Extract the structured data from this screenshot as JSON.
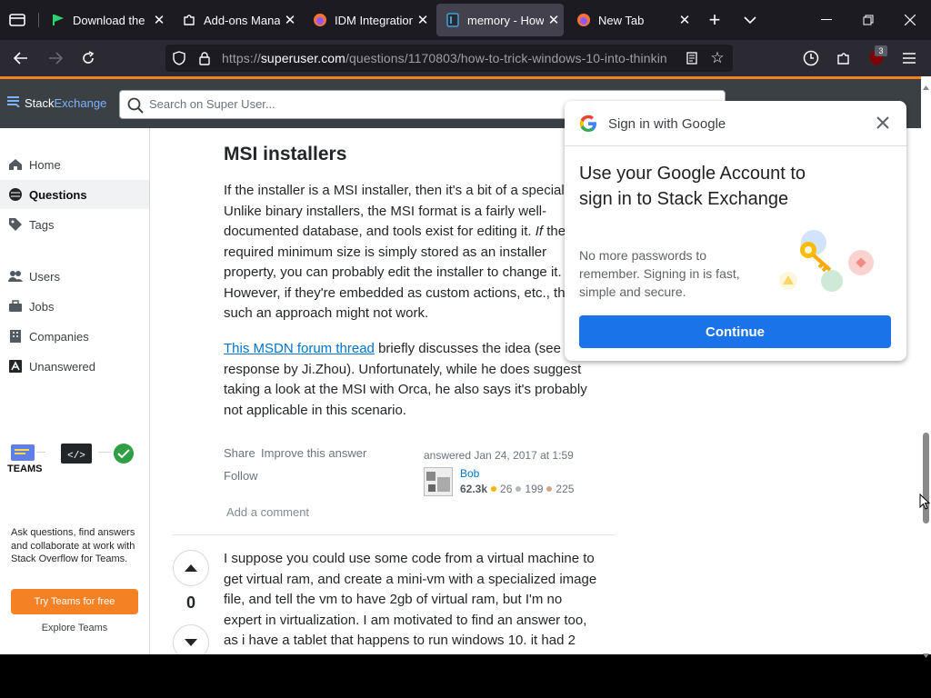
{
  "browser": {
    "tabs": [
      {
        "title": "Download the la",
        "favicon": "green-flag-icon"
      },
      {
        "title": "Add-ons Manag",
        "favicon": "puzzle-icon"
      },
      {
        "title": "IDM Integration",
        "favicon": "firefox-icon"
      },
      {
        "title": "memory - How",
        "favicon": "superuser-icon",
        "active": true
      },
      {
        "title": "New Tab",
        "favicon": "firefox-icon"
      }
    ],
    "url_prefix": "https://",
    "url_host": "superuser.com",
    "url_path": "/questions/1170803/how-to-trick-windows-10-into-thinkin",
    "extension_badge": "3"
  },
  "site": {
    "logo_a": "Stack",
    "logo_b": "Exchange",
    "search_placeholder": "Search on Super User..."
  },
  "leftnav": {
    "items": [
      {
        "label": "Home",
        "icon": "home-icon"
      },
      {
        "label": "Questions",
        "icon": "globe-icon",
        "selected": true
      },
      {
        "label": "Tags",
        "icon": "tag-icon"
      },
      {
        "label": "Users",
        "icon": "users-icon"
      },
      {
        "label": "Jobs",
        "icon": "briefcase-icon"
      },
      {
        "label": "Companies",
        "icon": "building-icon"
      },
      {
        "label": "Unanswered",
        "icon": "unanswered-icon"
      }
    ],
    "teams_heading": "TEAMS",
    "teams_text": "Ask questions, find answers and collaborate at work with Stack Overflow for Teams.",
    "teams_button": "Try Teams for free",
    "teams_explore": "Explore Teams"
  },
  "answer": {
    "heading": "MSI installers",
    "p1_a": "If the installer is a MSI installer, then it's a bit of a special",
    "p1_b": "Unlike binary installers, the MSI format is a fairly well-",
    "p1_c": "documented database, and tools exist for editing it.",
    "p1_c_italic": "If",
    "p1_c_tail": "the",
    "p1_d": "required minimum size is simply stored as an installer",
    "p1_e": "property, you can probably edit the installer to change it.",
    "p1_f": "However, if they're embedded as custom actions, etc., the",
    "p1_g": "such an approach might not work.",
    "p2_link": "This MSDN forum thread",
    "p2_a": "briefly discusses the idea (see th",
    "p2_b": "response by Ji.Zhou). Unfortunately, while he does suggest",
    "p2_c": "taking a look at the MSI with Orca, he also says it's probably",
    "p2_d": "not applicable in this scenario.",
    "share": "Share",
    "improve": "Improve this answer",
    "follow": "Follow",
    "answered": "answered Jan 24, 2017 at 1:59",
    "user": "Bob",
    "rep": "62.3k",
    "gold": "26",
    "silver": "199",
    "bronze": "225",
    "add_comment": "Add a comment"
  },
  "answer2": {
    "score": "0",
    "l1": "I suppose you could use some code from a virtual machine to",
    "l2": "get virtual ram, and create a mini-vm with a specialized image",
    "l3": "file, and tell the vm to have 2gb of virtual ram, but I'm no",
    "l4": "expert in virtualization. I am motivated to find an answer too,",
    "l5": "as i have a tablet that happens to run windows 10. it had 2"
  },
  "google_popup": {
    "header": "Sign in with Google",
    "title": "Use your Google Account to sign in to Stack Exchange",
    "desc": "No more passwords to remember. Signing in is fast, simple and secure.",
    "button": "Continue"
  },
  "colors": {
    "accent_orange": "#f48225",
    "link_blue": "#0074cc",
    "google_blue": "#1a73e8"
  }
}
